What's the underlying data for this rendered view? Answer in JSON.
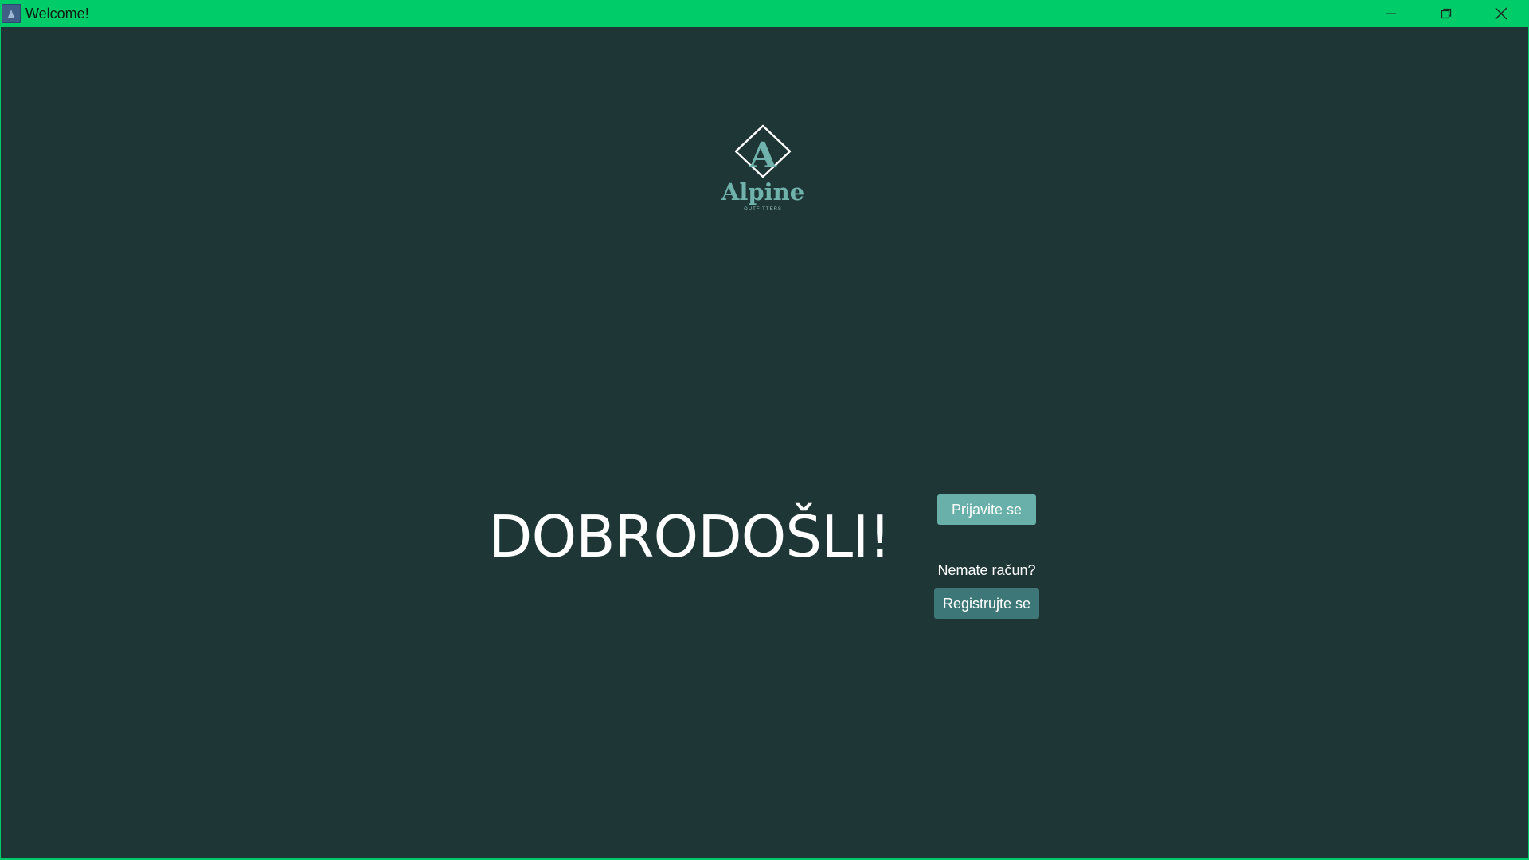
{
  "window": {
    "title": "Welcome!",
    "icon": "app-icon",
    "controls": [
      "minimize-icon",
      "restore-icon",
      "close-icon"
    ]
  },
  "logo": {
    "brand": "Alpine",
    "tagline": "OUTFITTERS",
    "mark": "A"
  },
  "main": {
    "headline": "DOBRODOŠLI!",
    "login_label": "Prijavite se",
    "no_account_text": "Nemate račun?",
    "register_label": "Registrujte se"
  },
  "colors": {
    "titlebar": "#00cc6a",
    "background": "#1f3636",
    "login_button": "#68b0a9",
    "register_button": "#3e7777",
    "logo": "#6fb3ac"
  }
}
